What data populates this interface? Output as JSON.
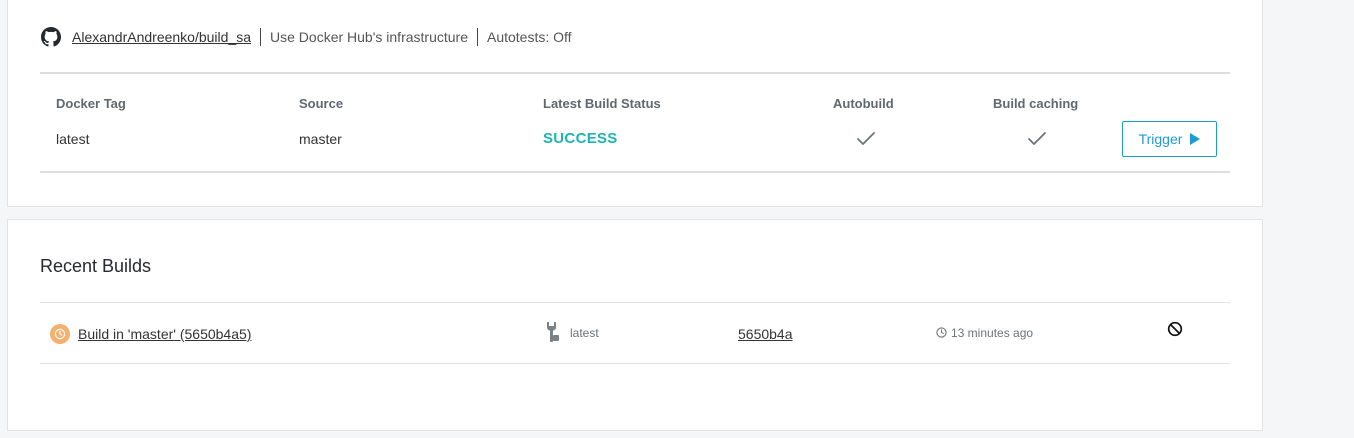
{
  "repo": {
    "link_text": "AlexandrAndreenko/build_sa",
    "infrastructure": "Use Docker Hub's infrastructure",
    "autotests": "Autotests: Off"
  },
  "build_rules": {
    "headers": {
      "docker_tag": "Docker Tag",
      "source": "Source",
      "latest_build_status": "Latest Build Status",
      "autobuild": "Autobuild",
      "build_caching": "Build caching"
    },
    "row": {
      "docker_tag": "latest",
      "source": "master",
      "status": "SUCCESS",
      "autobuild": "on",
      "build_caching": "on"
    },
    "trigger_label": "Trigger"
  },
  "recent_builds": {
    "title": "Recent Builds",
    "items": [
      {
        "name": "Build in 'master' (5650b4a5)",
        "tag": "latest",
        "commit": "5650b4a",
        "time": "13 minutes ago",
        "status_icon": "pending-clock-icon"
      }
    ]
  },
  "colors": {
    "success": "#1bb5b5",
    "accent": "#1d9bd6",
    "pending": "#f4b16e"
  }
}
